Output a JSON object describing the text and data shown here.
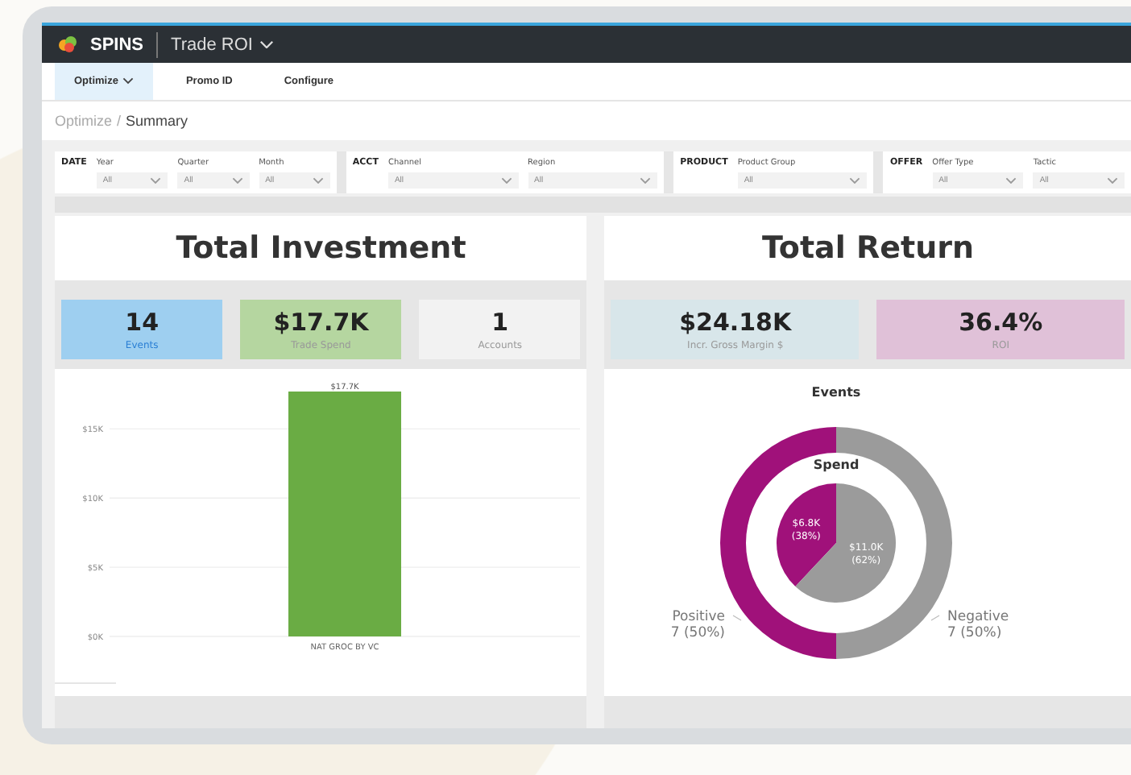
{
  "app": {
    "brand": "SPINS",
    "title": "Trade ROI"
  },
  "nav": [
    {
      "label": "Optimize",
      "selected": true,
      "dropdown": true
    },
    {
      "label": "Promo ID",
      "selected": false,
      "dropdown": false
    },
    {
      "label": "Configure",
      "selected": false,
      "dropdown": false
    }
  ],
  "breadcrumb": {
    "parent": "Optimize",
    "separator": "/",
    "current": "Summary"
  },
  "filter_groups": [
    {
      "label": "DATE",
      "filters": [
        {
          "label": "Year",
          "value": "All"
        },
        {
          "label": "Quarter",
          "value": "All"
        },
        {
          "label": "Month",
          "value": "All"
        }
      ]
    },
    {
      "label": "ACCT",
      "filters": [
        {
          "label": "Channel",
          "value": "All"
        },
        {
          "label": "Region",
          "value": "All"
        }
      ]
    },
    {
      "label": "PRODUCT",
      "filters": [
        {
          "label": "Product Group",
          "value": "All"
        }
      ]
    },
    {
      "label": "OFFER",
      "filters": [
        {
          "label": "Offer Type",
          "value": "All"
        },
        {
          "label": "Tactic",
          "value": "All"
        }
      ]
    }
  ],
  "panels": [
    {
      "title": "Total Investment",
      "kpis": [
        {
          "value": "14",
          "label": "Events",
          "color": "#9ecff0"
        },
        {
          "value": "$17.7K",
          "label": "Trade Spend",
          "color": "#b5d6a0"
        },
        {
          "value": "1",
          "label": "Accounts",
          "color": "#f2f2f2"
        }
      ],
      "chart_data": {
        "type": "bar",
        "categories": [
          "NAT GROC BY VC"
        ],
        "values": [
          17.7
        ],
        "colors": [
          "#6aac44"
        ],
        "grid": true,
        "ylim": [
          0,
          17.7
        ],
        "yticks": [
          {
            "value": 0,
            "label": "$0K"
          },
          {
            "value": 5,
            "label": "$5K"
          },
          {
            "value": 10,
            "label": "$10K"
          },
          {
            "value": 15,
            "label": "$15K"
          }
        ],
        "value_labels": [
          "$17.7K"
        ]
      }
    },
    {
      "title": "Total Return",
      "kpis": [
        {
          "value": "$24.18K",
          "label": "Incr. Gross Margin $",
          "color": "#d8e6ea"
        },
        {
          "value": "36.4%",
          "label": "ROI",
          "color": "#e0c1d8"
        }
      ],
      "events_chart": {
        "chart_data": {
          "type": "donut",
          "title": "Events",
          "categories": [
            "Positive",
            "Negative"
          ],
          "values": [
            7,
            7
          ],
          "value_labels": [
            "7 (50%)",
            "7 (50%)"
          ],
          "colors": [
            "#a0117a",
            "#9b9b9b"
          ]
        }
      },
      "spend_chart": {
        "chart_data": {
          "type": "pie",
          "title": "Spend",
          "values": [
            38,
            62
          ],
          "value_labels": [
            "$6.8K (38%)",
            "$11.0K (62%)"
          ],
          "colors": [
            "#a0117a",
            "#9b9b9b"
          ]
        }
      }
    }
  ]
}
